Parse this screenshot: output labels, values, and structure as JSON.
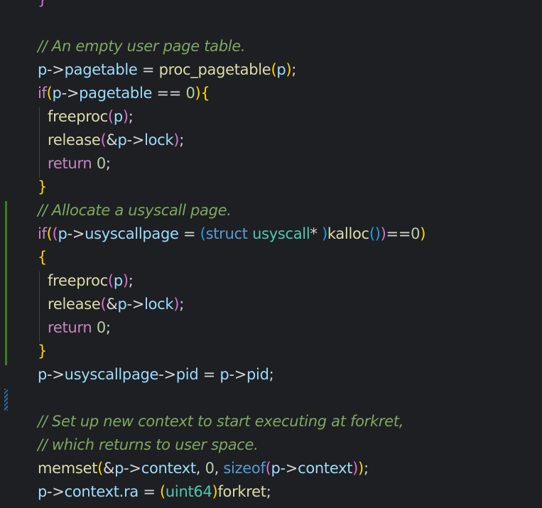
{
  "editor": {
    "language": "c",
    "lines": [
      {
        "tokens": [
          [
            "p2",
            "}"
          ]
        ]
      },
      {
        "tokens": []
      },
      {
        "tokens": [
          [
            "c",
            "// An empty user page table."
          ]
        ]
      },
      {
        "tokens": [
          [
            "v",
            "p"
          ],
          [
            "op",
            "->"
          ],
          [
            "v",
            "pagetable"
          ],
          [
            "op",
            " = "
          ],
          [
            "f",
            "proc_pagetable"
          ],
          [
            "p1",
            "("
          ],
          [
            "v",
            "p"
          ],
          [
            "p1",
            ")"
          ],
          [
            "op",
            ";"
          ]
        ]
      },
      {
        "tokens": [
          [
            "k",
            "if"
          ],
          [
            "p1",
            "("
          ],
          [
            "v",
            "p"
          ],
          [
            "op",
            "->"
          ],
          [
            "v",
            "pagetable"
          ],
          [
            "op",
            " == "
          ],
          [
            "n",
            "0"
          ],
          [
            "p1",
            ")"
          ],
          [
            "p1",
            "{"
          ]
        ]
      },
      {
        "indent": 1,
        "tokens": [
          [
            "f",
            "freeproc"
          ],
          [
            "p2",
            "("
          ],
          [
            "v",
            "p"
          ],
          [
            "p2",
            ")"
          ],
          [
            "op",
            ";"
          ]
        ]
      },
      {
        "indent": 1,
        "tokens": [
          [
            "f",
            "release"
          ],
          [
            "p2",
            "("
          ],
          [
            "op",
            "&"
          ],
          [
            "v",
            "p"
          ],
          [
            "op",
            "->"
          ],
          [
            "v",
            "lock"
          ],
          [
            "p2",
            ")"
          ],
          [
            "op",
            ";"
          ]
        ]
      },
      {
        "indent": 1,
        "tokens": [
          [
            "k",
            "return"
          ],
          [
            "op",
            " "
          ],
          [
            "n",
            "0"
          ],
          [
            "op",
            ";"
          ]
        ]
      },
      {
        "tokens": [
          [
            "p1",
            "}"
          ]
        ]
      },
      {
        "tokens": [
          [
            "c",
            "// Allocate a usyscall page."
          ]
        ]
      },
      {
        "tokens": [
          [
            "k",
            "if"
          ],
          [
            "p1",
            "("
          ],
          [
            "p2",
            "("
          ],
          [
            "v",
            "p"
          ],
          [
            "op",
            "->"
          ],
          [
            "v",
            "usyscallpage"
          ],
          [
            "op",
            " = "
          ],
          [
            "p3",
            "("
          ],
          [
            "b",
            "struct"
          ],
          [
            "op",
            " "
          ],
          [
            "t",
            "usyscall"
          ],
          [
            "op",
            "* "
          ],
          [
            "p3",
            ")"
          ],
          [
            "f",
            "kalloc"
          ],
          [
            "p3",
            "("
          ],
          [
            "p3",
            ")"
          ],
          [
            "p2",
            ")"
          ],
          [
            "op",
            "=="
          ],
          [
            "n",
            "0"
          ],
          [
            "p1",
            ")"
          ]
        ]
      },
      {
        "tokens": [
          [
            "p1",
            "{"
          ]
        ]
      },
      {
        "indent": 1,
        "tokens": [
          [
            "f",
            "freeproc"
          ],
          [
            "p2",
            "("
          ],
          [
            "v",
            "p"
          ],
          [
            "p2",
            ")"
          ],
          [
            "op",
            ";"
          ]
        ]
      },
      {
        "indent": 1,
        "tokens": [
          [
            "f",
            "release"
          ],
          [
            "p2",
            "("
          ],
          [
            "op",
            "&"
          ],
          [
            "v",
            "p"
          ],
          [
            "op",
            "->"
          ],
          [
            "v",
            "lock"
          ],
          [
            "p2",
            ")"
          ],
          [
            "op",
            ";"
          ]
        ]
      },
      {
        "indent": 1,
        "tokens": [
          [
            "k",
            "return"
          ],
          [
            "op",
            " "
          ],
          [
            "n",
            "0"
          ],
          [
            "op",
            ";"
          ]
        ]
      },
      {
        "tokens": [
          [
            "p1",
            "}"
          ]
        ]
      },
      {
        "tokens": [
          [
            "v",
            "p"
          ],
          [
            "op",
            "->"
          ],
          [
            "v",
            "usyscallpage"
          ],
          [
            "op",
            "->"
          ],
          [
            "v",
            "pid"
          ],
          [
            "op",
            " = "
          ],
          [
            "v",
            "p"
          ],
          [
            "op",
            "->"
          ],
          [
            "v",
            "pid"
          ],
          [
            "op",
            ";"
          ]
        ]
      },
      {
        "tokens": []
      },
      {
        "tokens": [
          [
            "c",
            "// Set up new context to start executing at forkret,"
          ]
        ]
      },
      {
        "tokens": [
          [
            "c",
            "// which returns to user space."
          ]
        ]
      },
      {
        "tokens": [
          [
            "f",
            "memset"
          ],
          [
            "p1",
            "("
          ],
          [
            "op",
            "&"
          ],
          [
            "v",
            "p"
          ],
          [
            "op",
            "->"
          ],
          [
            "v",
            "context"
          ],
          [
            "op",
            ", "
          ],
          [
            "n",
            "0"
          ],
          [
            "op",
            ", "
          ],
          [
            "b",
            "sizeof"
          ],
          [
            "p2",
            "("
          ],
          [
            "v",
            "p"
          ],
          [
            "op",
            "->"
          ],
          [
            "v",
            "context"
          ],
          [
            "p2",
            ")"
          ],
          [
            "p1",
            ")"
          ],
          [
            "op",
            ";"
          ]
        ]
      },
      {
        "tokens": [
          [
            "v",
            "p"
          ],
          [
            "op",
            "->"
          ],
          [
            "v",
            "context"
          ],
          [
            "op",
            "."
          ],
          [
            "v",
            "ra"
          ],
          [
            "op",
            " = "
          ],
          [
            "p1",
            "("
          ],
          [
            "t",
            "uint64"
          ],
          [
            "p1",
            ")"
          ],
          [
            "f",
            "forkret"
          ],
          [
            "op",
            ";"
          ]
        ]
      }
    ]
  }
}
